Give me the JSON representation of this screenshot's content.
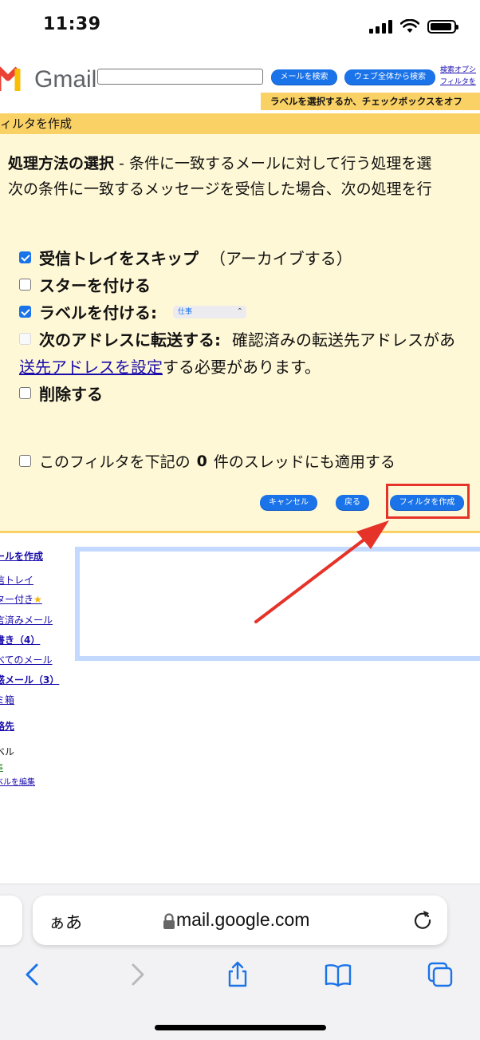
{
  "status_bar": {
    "time": "11:39"
  },
  "gmail_header": {
    "wordmark": "Gmail",
    "search_mail_button": "メールを検索",
    "search_web_button": "ウェブ全体から検索",
    "link_search_options": "検索オプシ",
    "link_create_filter": "フィルタを",
    "hint_bar": "ラベルを選択するか、チェックボックスをオフ"
  },
  "filter": {
    "title": "ィルタを作成",
    "heading_bold": "処理方法の選択",
    "heading_rest": " - 条件に一致するメールに対して行う処理を選",
    "condition_text": "次の条件に一致するメッセージを受信した場合、次の処理を行",
    "options": {
      "skip_inbox": {
        "label": "受信トレイをスキップ",
        "sub": "（アーカイブする）",
        "checked": true
      },
      "star": {
        "label": "スターを付ける",
        "checked": false
      },
      "apply_label": {
        "label": "ラベルを付ける:",
        "checked": true,
        "selected_label": "仕事"
      },
      "forward": {
        "label": "次のアドレスに転送する:",
        "sub": "確認済みの転送先アドレスがあ",
        "checked": false,
        "disabled": true
      },
      "forward_link": "送先アドレスを設定",
      "forward_rest": "する必要があります。",
      "delete": {
        "label": "削除する",
        "checked": false
      }
    },
    "apply_prefix": "このフィルタを下記の",
    "apply_count": "0",
    "apply_suffix": "件のスレッドにも適用する",
    "cancel_button": "キャンセル",
    "back_button": "戻る",
    "create_button": "フィルタを作成"
  },
  "sidebar": {
    "compose": "ールを作成",
    "inbox": "信トレイ",
    "starred": "ター付き",
    "sent": "言済みメール",
    "drafts": "書き（4）",
    "all_mail": "べてのメール",
    "spam": "惑メール（3）",
    "trash": "ミ箱",
    "contacts": "絡先",
    "labels_heading": "ベル",
    "label_work": "事",
    "edit_labels": "ベルを編集"
  },
  "safari": {
    "aa": "ぁあ",
    "url": "mail.google.com"
  },
  "colors": {
    "accent_blue": "#1a73e8",
    "filter_yellow": "#fad165",
    "panel_bg": "#fff8d6",
    "highlight_red": "#e5332a"
  }
}
